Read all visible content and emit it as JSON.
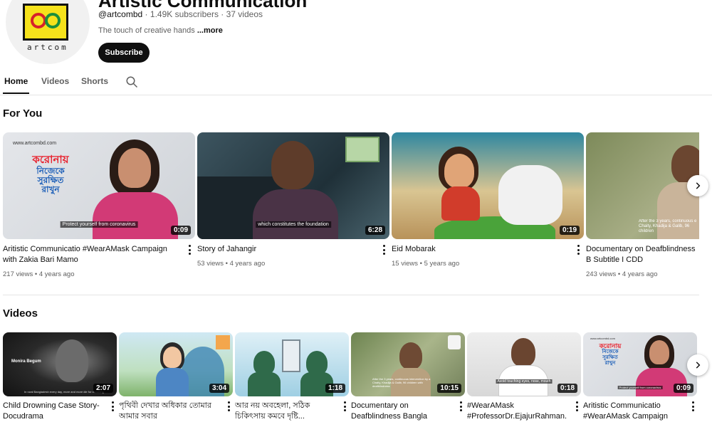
{
  "channel": {
    "name": "Artistic Communication",
    "avatar_text": "artcom",
    "handle": "@artcombd",
    "subscribers": "1.49K subscribers",
    "video_count": "37 videos",
    "separator": "·",
    "description": "The touch of creative hands",
    "more_label": "...more",
    "subscribe_label": "Subscribe"
  },
  "tabs": [
    {
      "label": "Home",
      "active": true
    },
    {
      "label": "Videos",
      "active": false
    },
    {
      "label": "Shorts",
      "active": false
    }
  ],
  "for_you": {
    "title": "For You",
    "items": [
      {
        "title": "Aritistic Communicatio #WearAMask Campaign with Zakia Bari Mamo",
        "views": "217 views",
        "age": "4 years ago",
        "duration": "0:09",
        "caption": "Protect yourself from coronavirus",
        "site": "www.artcombd.com"
      },
      {
        "title": "Story of Jahangir",
        "views": "53 views",
        "age": "4 years ago",
        "duration": "6:28",
        "caption": "which constitutes the foundation"
      },
      {
        "title": "Eid Mobarak",
        "views": "15 views",
        "age": "5 years ago",
        "duration": "0:19"
      },
      {
        "title": "Documentary on Deafblindness B Subtitle I CDD",
        "views": "243 views",
        "age": "4 years ago",
        "caption": "After the 3 years, continuous e Chaity, Khadija & Galib, 96 children"
      }
    ]
  },
  "videos": {
    "title": "Videos",
    "items": [
      {
        "title": "Child Drowning Case Story- Docudrama",
        "duration": "2:07",
        "caption": "Monira Begum",
        "caption2": "In rural Bangladesh every day, more and more die for drowning"
      },
      {
        "title": "পৃথিবী দেখার অধিকার তোমার আমার সবার",
        "duration": "3:04"
      },
      {
        "title": "আর নয় অবহেলা, সঠিক চিকিৎসায় কমবে দৃষ্টি...",
        "duration": "1:18"
      },
      {
        "title": "Documentary on Deafblindness Bangla Final...",
        "duration": "10:15",
        "caption": "After the 3 years, continuous intervention by a Chaity, Khadija & Galib, 96 children with deafblindness"
      },
      {
        "title": "#WearAMask #ProfessorDr.EjajurRahman...",
        "duration": "0:18",
        "caption": "Avoid touching eyes, nose, mouth"
      },
      {
        "title": "Aritistic Communicatio #WearAMask Campaign wit...",
        "duration": "0:09",
        "caption": "Protect yourself from coronavirus",
        "site": "www.artcombd.com"
      }
    ]
  },
  "bangla_poster": {
    "line1": "করোনায়",
    "line2": "নিজেকে",
    "line3": "সুরক্ষিত",
    "line4": "রাখুন"
  },
  "colors": {
    "text_primary": "#0f0f0f",
    "text_secondary": "#606060",
    "subscribe_bg": "#0f0f0f"
  }
}
